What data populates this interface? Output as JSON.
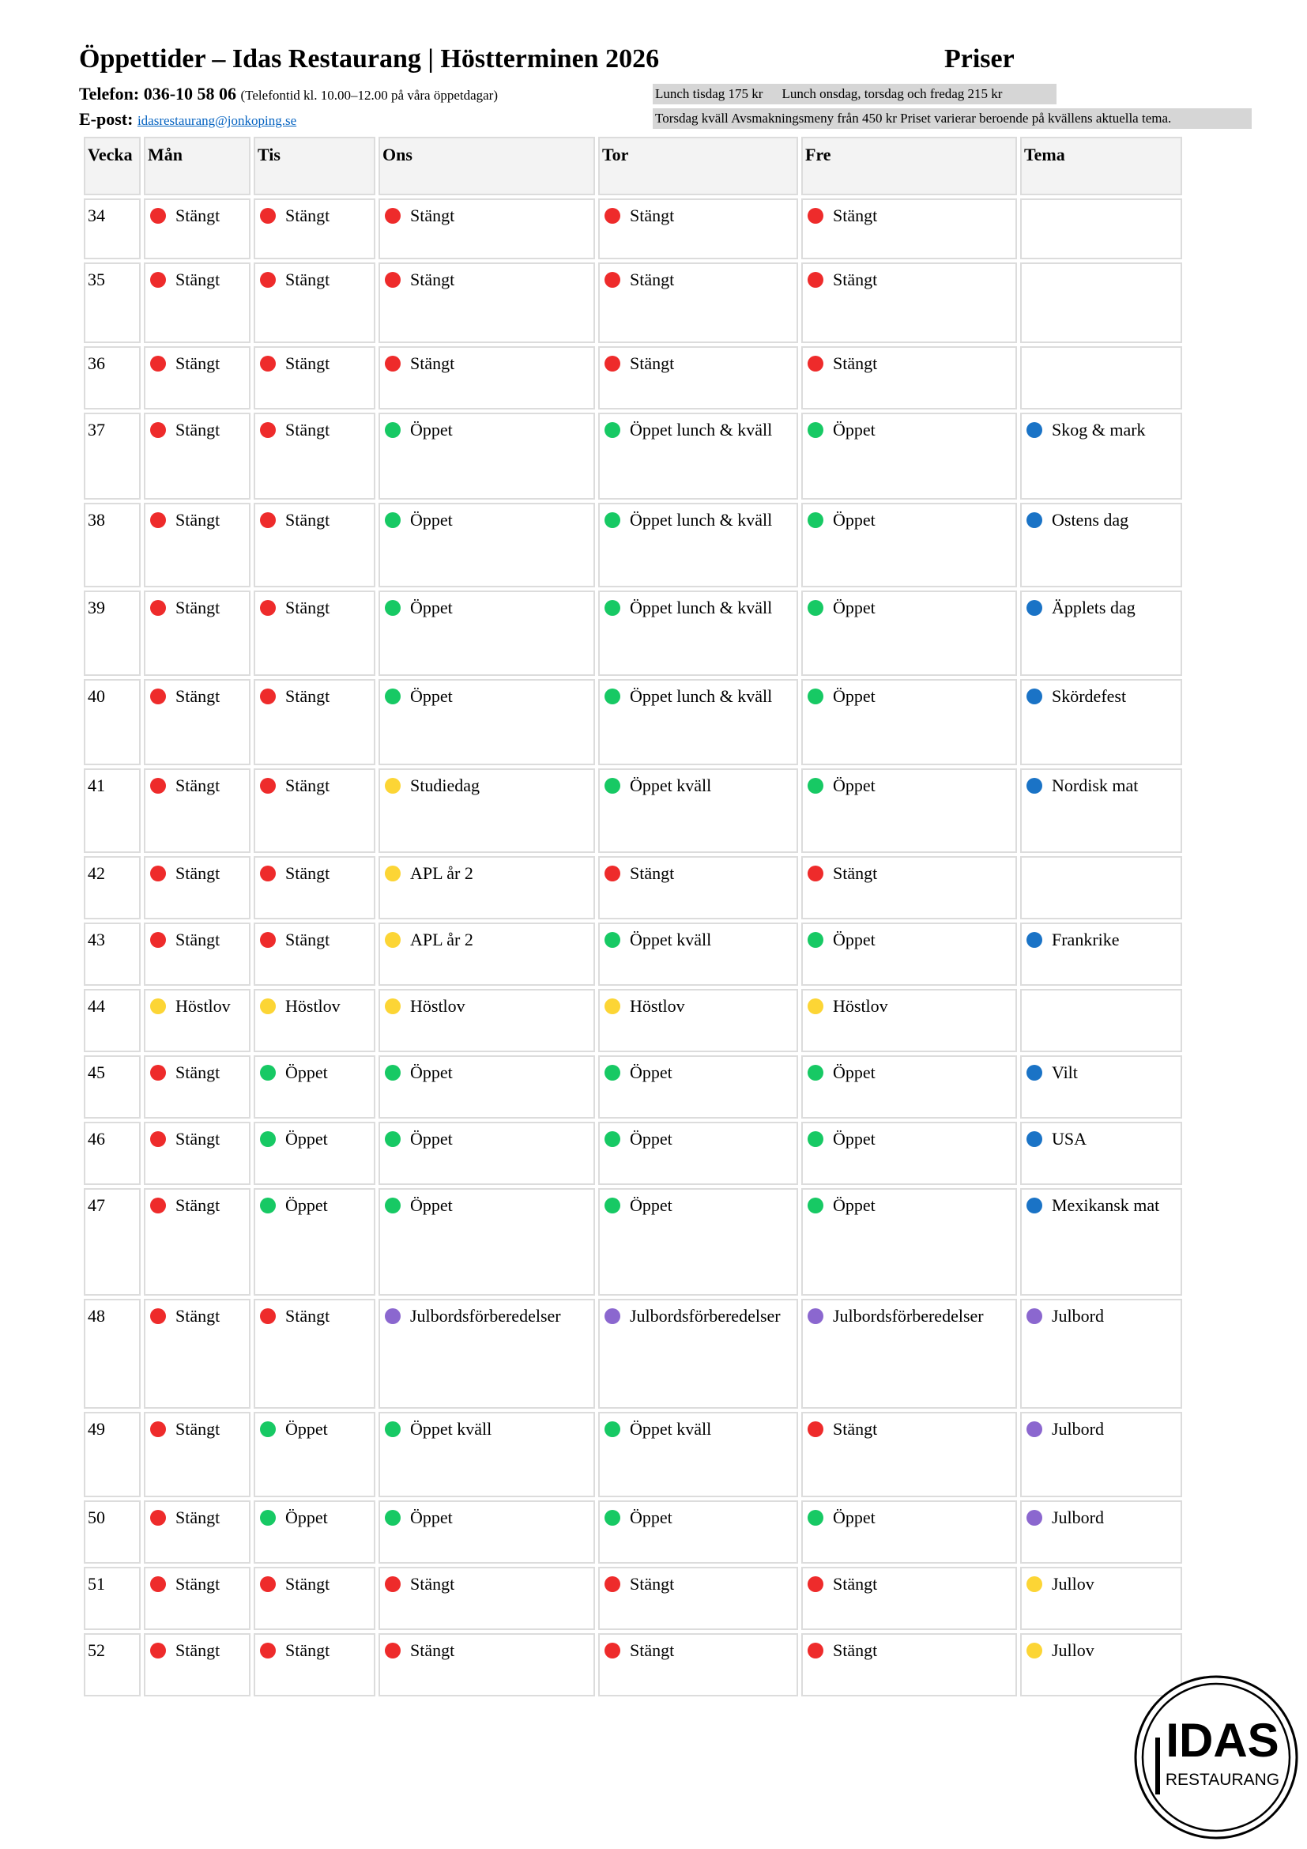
{
  "header": {
    "title": "Öppettider – Idas Restaurang | Höstterminen 2026",
    "prices_title": "Priser",
    "phone_label": "Telefon:",
    "phone_number": "036-10 58 06",
    "phone_note": "(Telefontid kl. 10.00–12.00 på våra öppetdagar)",
    "email_label": "E-post:",
    "email": "idasrestaurang@jonkoping.se"
  },
  "prices": {
    "lunch_tuesday": "Lunch tisdag 175 kr",
    "lunch_other": "Lunch onsdag, torsdag och fredag 215 kr",
    "evening": "Torsdag kväll Avsmakningsmeny från 450 kr Priset varierar beroende på kvällens aktuella tema."
  },
  "colors": {
    "red": "#ee2b2b",
    "green": "#17c964",
    "yellow": "#fcd535",
    "purple": "#8b67cf",
    "blue": "#1a73c6"
  },
  "table": {
    "headers": [
      "Vecka",
      "Mån",
      "Tis",
      "Ons",
      "Tor",
      "Fre",
      "Tema"
    ],
    "rows": [
      {
        "week": "34",
        "mon": "Stängt",
        "tue": "Stängt",
        "wed": "Stängt",
        "thu": "Stängt",
        "fri": "Stängt",
        "theme": ""
      },
      {
        "week": "35",
        "mon": "Stängt",
        "tue": "Stängt",
        "wed": "Stängt",
        "thu": "Stängt",
        "fri": "Stängt",
        "theme": ""
      },
      {
        "week": "36",
        "mon": "Stängt",
        "tue": "Stängt",
        "wed": "Stängt",
        "thu": "Stängt",
        "fri": "Stängt",
        "theme": ""
      },
      {
        "week": "37",
        "mon": "Stängt",
        "tue": "Stängt",
        "wed": "Öppet",
        "thu": "Öppet lunch & kväll",
        "fri": "Öppet",
        "theme": "Skog & mark"
      },
      {
        "week": "38",
        "mon": "Stängt",
        "tue": "Stängt",
        "wed": "Öppet",
        "thu": "Öppet lunch & kväll",
        "fri": "Öppet",
        "theme": "Ostens dag"
      },
      {
        "week": "39",
        "mon": "Stängt",
        "tue": "Stängt",
        "wed": "Öppet",
        "thu": "Öppet lunch & kväll",
        "fri": "Öppet",
        "theme": "Äpplets dag"
      },
      {
        "week": "40",
        "mon": "Stängt",
        "tue": "Stängt",
        "wed": "Öppet",
        "thu": "Öppet lunch & kväll",
        "fri": "Öppet",
        "theme": "Skördefest"
      },
      {
        "week": "41",
        "mon": "Stängt",
        "tue": "Stängt",
        "wed": "Studiedag",
        "thu": "Öppet kväll",
        "fri": "Öppet",
        "theme": "Nordisk mat"
      },
      {
        "week": "42",
        "mon": "Stängt",
        "tue": "Stängt",
        "wed": "APL år 2",
        "thu": "Stängt",
        "fri": "Stängt",
        "theme": ""
      },
      {
        "week": "43",
        "mon": "Stängt",
        "tue": "Stängt",
        "wed": "APL år 2",
        "thu": "Öppet kväll",
        "fri": "Öppet",
        "theme": "Frankrike"
      },
      {
        "week": "44",
        "mon": "Höstlov",
        "tue": "Höstlov",
        "wed": "Höstlov",
        "thu": "Höstlov",
        "fri": "Höstlov",
        "theme": ""
      },
      {
        "week": "45",
        "mon": "Stängt",
        "tue": "Öppet",
        "wed": "Öppet",
        "thu": "Öppet",
        "fri": "Öppet",
        "theme": "Vilt"
      },
      {
        "week": "46",
        "mon": "Stängt",
        "tue": "Öppet",
        "wed": "Öppet",
        "thu": "Öppet",
        "fri": "Öppet",
        "theme": "USA"
      },
      {
        "week": "47",
        "mon": "Stängt",
        "tue": "Öppet",
        "wed": "Öppet",
        "thu": "Öppet",
        "fri": "Öppet",
        "theme": "Mexikansk mat"
      },
      {
        "week": "48",
        "mon": "Stängt",
        "tue": "Stängt",
        "wed": "Julbordsförberedelser",
        "thu": "Julbordsförberedelser",
        "fri": "Julbordsförberedelser",
        "theme": "Julbord"
      },
      {
        "week": "49",
        "mon": "Stängt",
        "tue": "Öppet",
        "wed": "Öppet kväll",
        "thu": "Öppet kväll",
        "fri": "Stängt",
        "theme": "Julbord"
      },
      {
        "week": "50",
        "mon": "Stängt",
        "tue": "Öppet",
        "wed": "Öppet",
        "thu": "Öppet",
        "fri": "Öppet",
        "theme": "Julbord"
      },
      {
        "week": "51",
        "mon": "Stängt",
        "tue": "Stängt",
        "wed": "Stängt",
        "thu": "Stängt",
        "fri": "Stängt",
        "theme": "Jullov"
      },
      {
        "week": "52",
        "mon": "Stängt",
        "tue": "Stängt",
        "wed": "Stängt",
        "thu": "Stängt",
        "fri": "Stängt",
        "theme": "Jullov"
      }
    ]
  },
  "logo": {
    "line1": "IDAS",
    "line2": "RESTAURANG"
  }
}
